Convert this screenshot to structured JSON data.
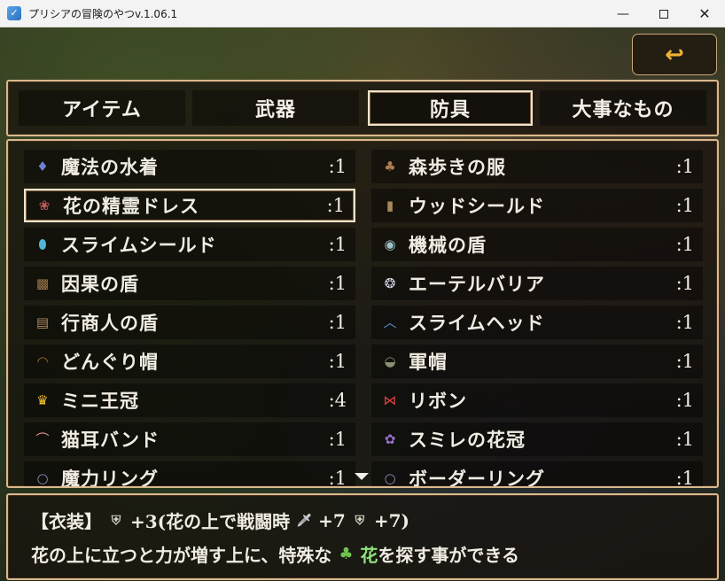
{
  "window": {
    "title": "プリシアの冒険のやつv.1.06.1",
    "min_glyph": "—",
    "close_glyph": "✕"
  },
  "back_button": {
    "glyph": "↩"
  },
  "tabs": [
    {
      "label": "アイテム",
      "selected": false
    },
    {
      "label": "武器",
      "selected": false
    },
    {
      "label": "防具",
      "selected": true
    },
    {
      "label": "大事なもの",
      "selected": false
    }
  ],
  "items": [
    {
      "name": "魔法の水着",
      "count": ":1",
      "icon": "swimsuit-icon",
      "glyph": "♦",
      "color": "#6d7fd0"
    },
    {
      "name": "森歩きの服",
      "count": ":1",
      "icon": "clothes-icon",
      "glyph": "♣",
      "color": "#b07a52"
    },
    {
      "name": "花の精霊ドレス",
      "count": ":1",
      "icon": "dress-icon",
      "glyph": "❀",
      "color": "#c25a5a",
      "selected": true
    },
    {
      "name": "ウッドシールド",
      "count": ":1",
      "icon": "wood-shield-icon",
      "glyph": "▮",
      "color": "#a88858"
    },
    {
      "name": "スライムシールド",
      "count": ":1",
      "icon": "slime-shield-icon",
      "glyph": "⬮",
      "color": "#4fb6d6"
    },
    {
      "name": "機械の盾",
      "count": ":1",
      "icon": "machine-shield-icon",
      "glyph": "◉",
      "color": "#9fc0c8"
    },
    {
      "name": "因果の盾",
      "count": ":1",
      "icon": "karma-shield-icon",
      "glyph": "▩",
      "color": "#a0784a"
    },
    {
      "name": "エーテルバリア",
      "count": ":1",
      "icon": "ether-barrier-icon",
      "glyph": "❂",
      "color": "#d8d8e8"
    },
    {
      "name": "行商人の盾",
      "count": ":1",
      "icon": "merchant-shield-icon",
      "glyph": "▤",
      "color": "#b08a60"
    },
    {
      "name": "スライムヘッド",
      "count": ":1",
      "icon": "slime-head-icon",
      "glyph": "︿",
      "color": "#5e8fd0"
    },
    {
      "name": "どんぐり帽",
      "count": ":1",
      "icon": "acorn-hat-icon",
      "glyph": "◠",
      "color": "#a86a2a"
    },
    {
      "name": "軍帽",
      "count": ":1",
      "icon": "military-cap-icon",
      "glyph": "◒",
      "color": "#8a9070"
    },
    {
      "name": "ミニ王冠",
      "count": ":4",
      "icon": "mini-crown-icon",
      "glyph": "♛",
      "color": "#f0c030"
    },
    {
      "name": "リボン",
      "count": ":1",
      "icon": "ribbon-icon",
      "glyph": "⋈",
      "color": "#e04040"
    },
    {
      "name": "猫耳バンド",
      "count": ":1",
      "icon": "cat-ears-icon",
      "glyph": "⌒",
      "color": "#d89090"
    },
    {
      "name": "スミレの花冠",
      "count": ":1",
      "icon": "violet-wreath-icon",
      "glyph": "✿",
      "color": "#9a70d0"
    },
    {
      "name": "魔力リング",
      "count": ":1",
      "icon": "magic-ring-icon",
      "glyph": "○",
      "color": "#9090c0"
    },
    {
      "name": "ボーダーリング",
      "count": ":1",
      "icon": "border-ring-icon",
      "glyph": "○",
      "color": "#9090c0"
    }
  ],
  "help": {
    "line1": {
      "prefix": "【衣装】",
      "part_a": "+3(花の上で戦闘時",
      "part_b": "+7",
      "part_c": "+7)",
      "defense_glyph": "⛨",
      "attack_glyph": "🗡"
    },
    "line2": {
      "part_a": "花の上に立つと力が増す上に、特殊な",
      "flower_word": "花",
      "part_b": "を探す事ができる",
      "clover_glyph": "♣",
      "clover_color": "#6ec24f"
    }
  }
}
